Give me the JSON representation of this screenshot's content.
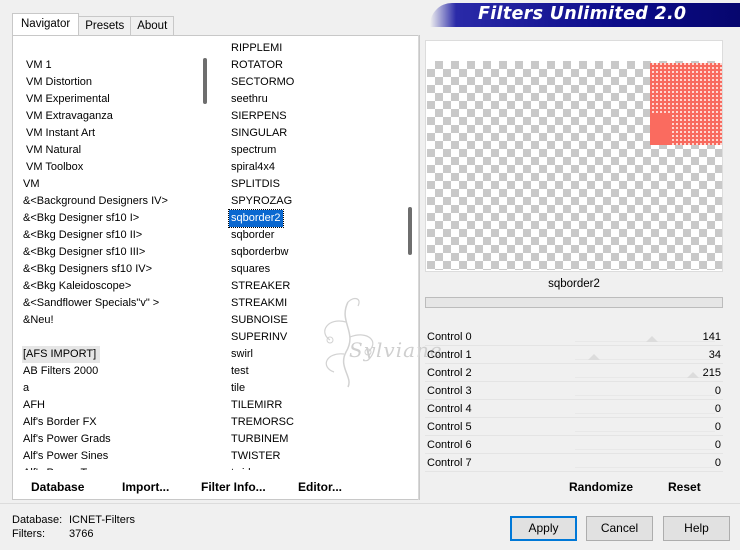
{
  "banner": {
    "title": "Filters Unlimited 2.0"
  },
  "tabs": [
    {
      "label": "Navigator",
      "active": true
    },
    {
      "label": "Presets",
      "active": false
    },
    {
      "label": "About",
      "active": false
    }
  ],
  "categories": [
    "VM 1",
    "VM Distortion",
    "VM Experimental",
    "VM Extravaganza",
    "VM Instant Art",
    "VM Natural",
    "VM Toolbox",
    "VM",
    "&<Background Designers IV>",
    "&<Bkg Designer sf10 I>",
    "&<Bkg Designer sf10 II>",
    "&<Bkg Designer sf10 III>",
    "&<Bkg Designers sf10 IV>",
    "&<Bkg Kaleidoscope>",
    "&<Sandflower Specials\"v\" >",
    "&Neu!",
    "",
    "[AFS IMPORT]",
    "AB Filters 2000",
    "a",
    "AFH",
    "Alf's Border FX",
    "Alf's Power Grads",
    "Alf's Power Sines",
    "Alf's Power Toys"
  ],
  "filters": [
    "RIPPLEMI",
    "ROTATOR",
    "SECTORMO",
    "seethru",
    "SIERPENS",
    "SINGULAR",
    "spectrum",
    "spiral4x4",
    "SPLITDIS",
    "SPYROZAG",
    "sqborder2",
    "sqborder",
    "sqborderbw",
    "squares",
    "STREAKER",
    "STREAKMI",
    "SUBNOISE",
    "SUPERINV",
    "swirl",
    "test",
    "tile",
    "TILEMIRR",
    "TREMORSC",
    "TURBINEM",
    "TWISTER",
    "twirl"
  ],
  "selected_filter": "sqborder2",
  "toolbar": {
    "database": "Database",
    "import": "Import...",
    "filter_info": "Filter Info...",
    "editor": "Editor..."
  },
  "preview": {
    "filter_name": "sqborder2",
    "accent": "#f86a5e"
  },
  "controls": [
    {
      "label": "Control 0",
      "value": "141",
      "level": 0.553
    },
    {
      "label": "Control 1",
      "value": "34",
      "level": 0.133
    },
    {
      "label": "Control 2",
      "value": "215",
      "level": 0.843
    },
    {
      "label": "Control 3",
      "value": "0",
      "level": 0
    },
    {
      "label": "Control 4",
      "value": "0",
      "level": 0
    },
    {
      "label": "Control 5",
      "value": "0",
      "level": 0
    },
    {
      "label": "Control 6",
      "value": "0",
      "level": 0
    },
    {
      "label": "Control 7",
      "value": "0",
      "level": 0
    }
  ],
  "actions": {
    "randomize": "Randomize",
    "reset": "Reset"
  },
  "status": {
    "database_label": "Database:",
    "database_value": "ICNET-Filters",
    "filters_label": "Filters:",
    "filters_value": "3766"
  },
  "buttons": {
    "apply": "Apply",
    "cancel": "Cancel",
    "help": "Help"
  },
  "watermark": {
    "text": "Sylviane"
  },
  "colors": {
    "selection": "#0a68d0",
    "banner": "#0c0c8a"
  }
}
